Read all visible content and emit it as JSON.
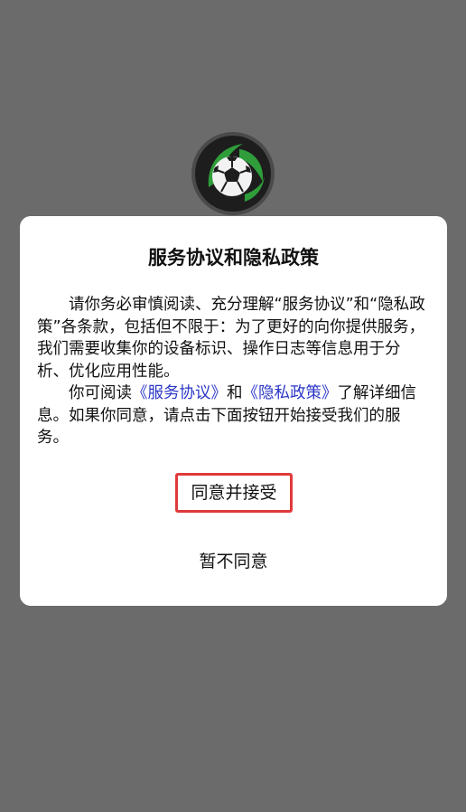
{
  "background_color": "#6b6b6b",
  "logo": {
    "icon": "soccer-ball-icon",
    "accent_color": "#2f9e3a"
  },
  "dialog": {
    "title": "服务协议和隐私政策",
    "paragraph1": "请你务必审慎阅读、充分理解“服务协议”和“隐私政策”各条款，包括但不限于：为了更好的向你提供服务，我们需要收集你的设备标识、操作日志等信息用于分析、优化应用性能。",
    "paragraph2": {
      "prefix": "你可阅读",
      "link_service": "《服务协议》",
      "middle": "和",
      "link_privacy": "《隐私政策》",
      "suffix": "了解详细信息。如果你同意，请点击下面按钮开始接受我们的服务。"
    },
    "link_color": "#2a36c6",
    "accept_label": "同意并接受",
    "accept_border_color": "#e03a3a",
    "decline_label": "暂不同意"
  }
}
